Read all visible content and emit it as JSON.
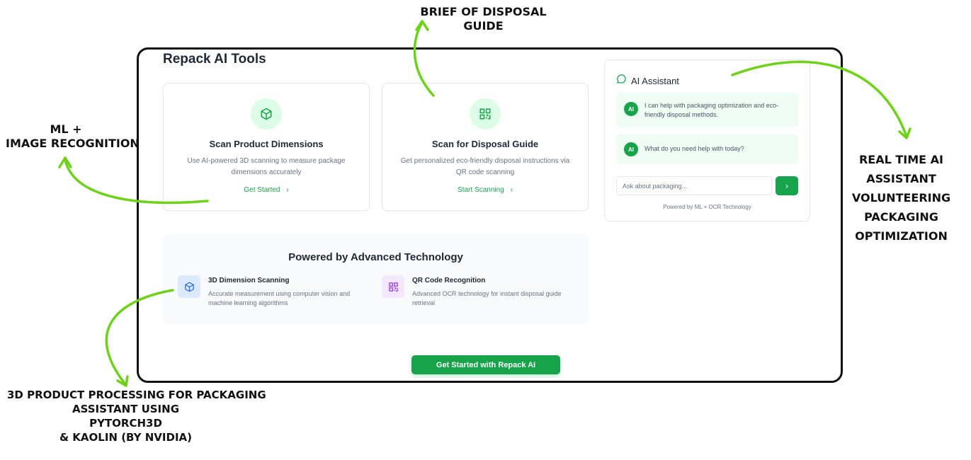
{
  "page": {
    "title": "Repack AI Tools"
  },
  "cards": [
    {
      "title": "Scan Product Dimensions",
      "description": "Use AI-powered 3D scanning to measure package dimensions accurately",
      "link": "Get Started",
      "icon": "cube-icon"
    },
    {
      "title": "Scan for Disposal Guide",
      "description": "Get personalized eco-friendly disposal instructions via QR code scanning",
      "link": "Start Scanning",
      "icon": "qr-code-icon"
    }
  ],
  "technology": {
    "title": "Powered by Advanced Technology",
    "items": [
      {
        "name": "3D Dimension Scanning",
        "description": "Accurate measurement using computer vision and machine learning algorithms",
        "icon": "cube-icon",
        "color": "#2563eb"
      },
      {
        "name": "QR Code Recognition",
        "description": "Advanced OCR technology for instant disposal guide retrieval",
        "icon": "qr-code-icon",
        "color": "#9333ea"
      }
    ]
  },
  "cta": {
    "label": "Get Started with Repack AI"
  },
  "assistant": {
    "title": "AI Assistant",
    "messages": [
      {
        "avatar": "AI",
        "text": "I can help with packaging optimization and eco-friendly disposal methods."
      },
      {
        "avatar": "AI",
        "text": "What do you need help with today?"
      }
    ],
    "input_placeholder": "Ask about packaging...",
    "send_icon": "›",
    "footer": "Powered by ML + OCR Technology"
  },
  "annotations": {
    "top": "BRIEF OF DISPOSAL GUIDE",
    "left": [
      "ML +",
      "IMAGE RECOGNITION"
    ],
    "right": [
      "REAL TIME AI",
      "ASSISTANT",
      "VOLUNTEERING",
      "PACKAGING",
      "OPTIMIZATION"
    ],
    "bottom": [
      "3D PRODUCT PROCESSING FOR PACKAGING",
      "ASSISTANT USING",
      "PYTORCH3D",
      "& KAOLIN (BY NVIDIA)"
    ]
  },
  "colors": {
    "accent": "#16a34a",
    "accent_light": "#dcfce7",
    "annotation_arrow": "#6fd21a"
  }
}
